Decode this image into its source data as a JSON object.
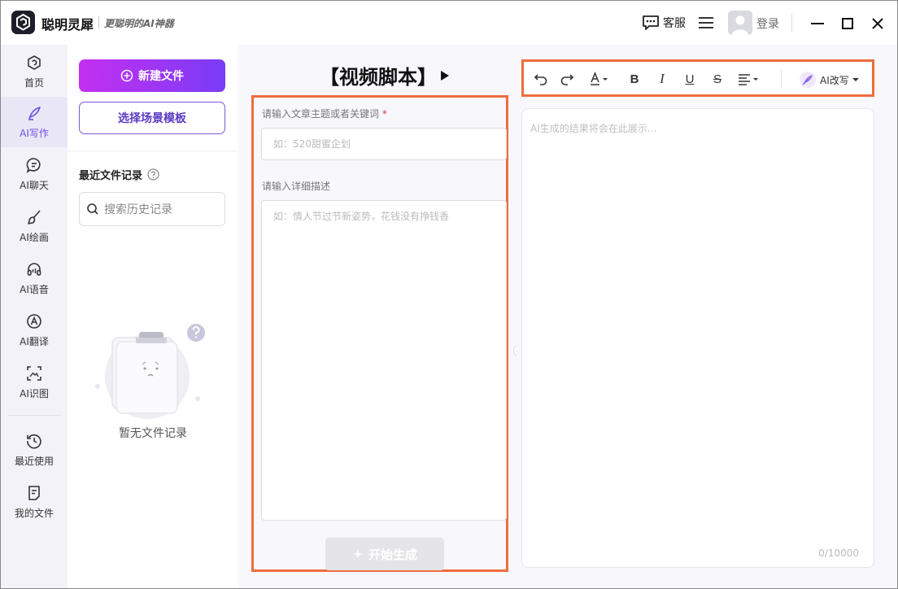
{
  "app": {
    "name": "聪明灵犀",
    "slogan": "更聪明的AI神器"
  },
  "titlebar": {
    "service_label": "客服",
    "login_label": "登录"
  },
  "sidebar": {
    "items": [
      {
        "label": "首页",
        "icon": "home-icon"
      },
      {
        "label": "AI写作",
        "icon": "pen-icon",
        "active": true
      },
      {
        "label": "AI聊天",
        "icon": "chat-icon"
      },
      {
        "label": "AI绘画",
        "icon": "brush-icon"
      },
      {
        "label": "AI语音",
        "icon": "headphones-icon"
      },
      {
        "label": "AI翻译",
        "icon": "translate-icon"
      },
      {
        "label": "AI识图",
        "icon": "scan-icon"
      },
      {
        "label": "最近使用",
        "icon": "history-icon"
      },
      {
        "label": "我的文件",
        "icon": "file-icon"
      }
    ]
  },
  "left_panel": {
    "new_file_label": "新建文件",
    "template_label": "选择场景模板",
    "recent_title": "最近文件记录",
    "search_placeholder": "搜索历史记录",
    "empty_text": "暂无文件记录"
  },
  "editor": {
    "title": "【视频脚本】",
    "topic_label": "请输入文章主题或者关键词",
    "required_mark": "*",
    "topic_placeholder": "如：520甜蜜企划",
    "detail_label": "请输入详细描述",
    "detail_placeholder": "如：情人节过节新姿势，花钱没有挣钱香",
    "generate_label": "开始生成"
  },
  "result": {
    "toolbar": {
      "ai_rewrite_label": "AI改写"
    },
    "placeholder": "AI生成的结果将会在此展示...",
    "counter": "0/10000"
  },
  "colors": {
    "accent": "#7a3cf6",
    "accent_start": "#c42ff0",
    "highlight_frame": "#ef6d3d"
  }
}
